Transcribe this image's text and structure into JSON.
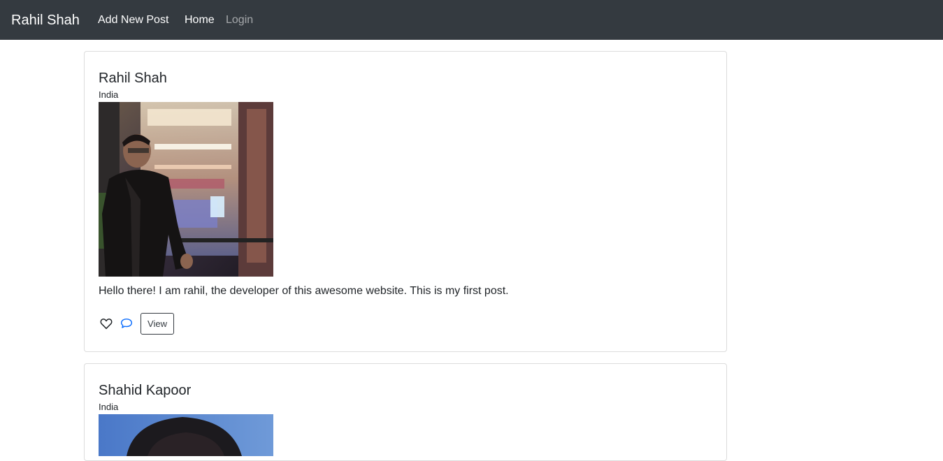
{
  "navbar": {
    "brand": "Rahil Shah",
    "links": {
      "add_new_post": "Add New Post",
      "home": "Home",
      "login": "Login"
    }
  },
  "posts": [
    {
      "author": "Rahil Shah",
      "country": "India",
      "caption": "Hello there! I am rahil, the developer of this awesome website. This is my first post.",
      "actions": {
        "like_icon": "heart-icon",
        "comment_icon": "comment-icon",
        "view_label": "View"
      }
    },
    {
      "author": "Shahid Kapoor",
      "country": "India"
    }
  ],
  "colors": {
    "navbar_bg": "#343a40",
    "comment_icon": "#0d6efd",
    "card_border": "#dcdcdc"
  }
}
